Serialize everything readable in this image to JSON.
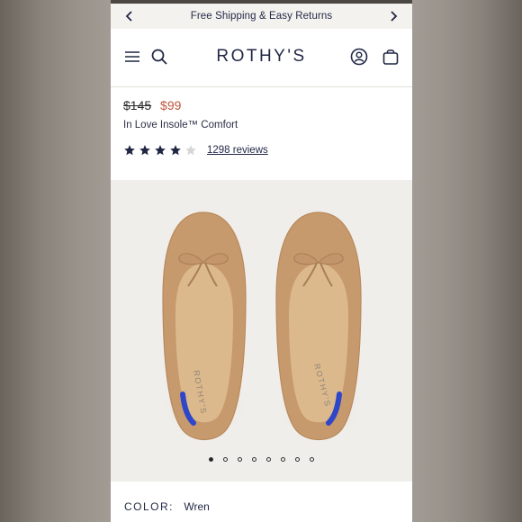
{
  "promo": {
    "text": "Free Shipping & Easy Returns"
  },
  "header": {
    "logo": "ROTHY'S"
  },
  "product": {
    "old_price": "$145",
    "new_price": "$99",
    "insole": "In Love Insole™ Comfort",
    "rating": 4,
    "rating_max": 5,
    "reviews_label": "1298 reviews"
  },
  "gallery": {
    "slide_count": 8,
    "active_index": 1
  },
  "color": {
    "label": "COLOR:",
    "value": "Wren"
  },
  "colors": {
    "navy": "#1f2744",
    "sale_red": "#c0533d",
    "shoe_tan": "#c79a6d",
    "heel_blue": "#2e47c9"
  },
  "icons": [
    "chevron-left-icon",
    "chevron-right-icon",
    "menu-icon",
    "search-icon",
    "account-icon",
    "bag-icon",
    "star-icon"
  ]
}
